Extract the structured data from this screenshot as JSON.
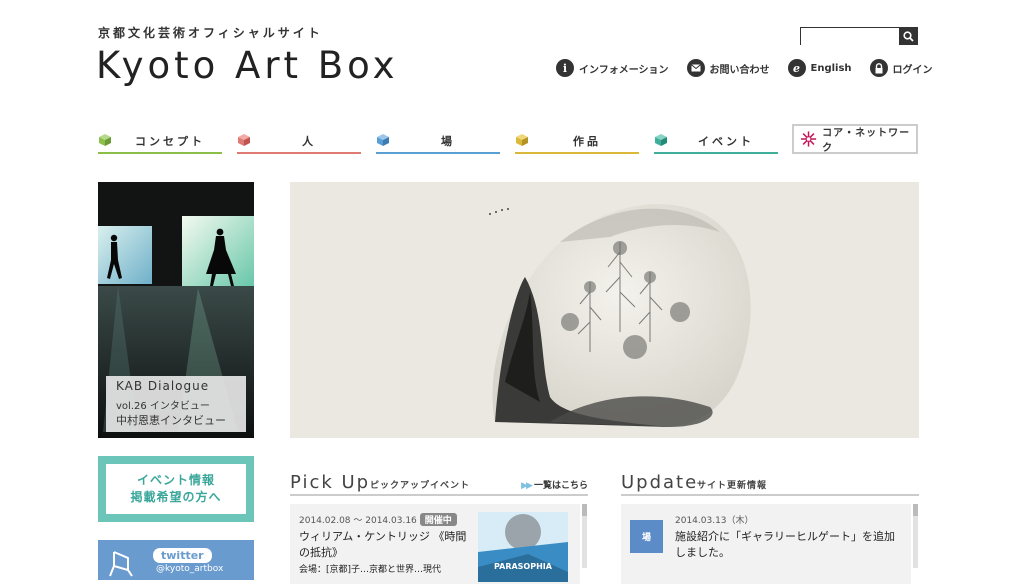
{
  "header": {
    "subtitle": "京都文化芸術オフィシャルサイト",
    "logo": "Kyoto Art Box",
    "search": {
      "placeholder": ""
    },
    "utility": [
      {
        "icon": "info-icon",
        "glyph": "i",
        "label": "インフォメーション"
      },
      {
        "icon": "mail-icon",
        "glyph": "✉",
        "label": "お問い合わせ"
      },
      {
        "icon": "english-icon",
        "glyph": "e",
        "label": "English"
      },
      {
        "icon": "lock-icon",
        "glyph": "🔒",
        "label": "ログイン"
      }
    ]
  },
  "nav": {
    "items": [
      {
        "label": "コンセプト",
        "color": "#8cbf4a"
      },
      {
        "label": "人",
        "color": "#e07a74"
      },
      {
        "label": "場",
        "color": "#5a9fd4"
      },
      {
        "label": "作品",
        "color": "#d9b83a"
      },
      {
        "label": "イベント",
        "color": "#3fae9a"
      }
    ],
    "core": {
      "label": "コア・ネットワーク",
      "color": "#c2185b"
    }
  },
  "dialogue": {
    "title": "KAB Dialogue",
    "vol": "vol.26 インタビュー",
    "name": "中村恩恵インタビュー"
  },
  "event_banner": {
    "line1": "イベント情報",
    "line2": "掲載希望の方へ"
  },
  "twitter": {
    "label": "twitter",
    "handle": "@kyoto_artbox"
  },
  "pickup": {
    "title": "Pick Up",
    "subtitle": "ピックアップイベント",
    "list_link": "一覧はこちら",
    "item": {
      "date": "2014.02.08 ～ 2014.03.16",
      "badge": "開催中",
      "text": "ウィリアム・ケントリッジ 《時間の抵抗》",
      "more": "会場：[京都]子…京都と世界…現代",
      "thumb_label": "PARASOPHIA"
    }
  },
  "update": {
    "title": "Update",
    "subtitle": "サイト更新情報",
    "item": {
      "tag": "場",
      "date": "2014.03.13（木）",
      "text": "施設紹介に「ギャラリーヒルゲート」を追加しました。"
    }
  }
}
